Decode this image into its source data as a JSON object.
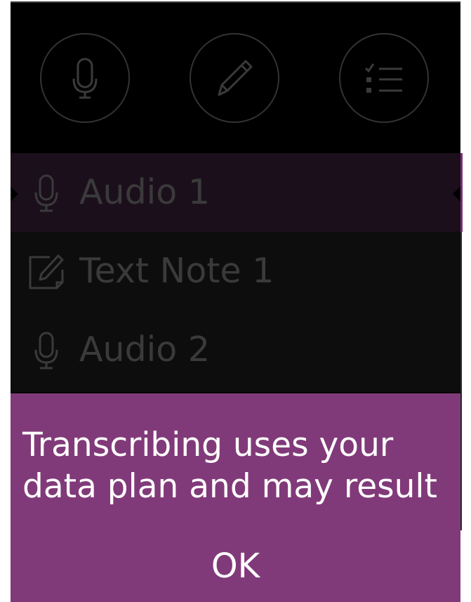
{
  "toolbar": {
    "buttons": [
      {
        "name": "record-audio",
        "icon": "microphone-icon"
      },
      {
        "name": "new-text-note",
        "icon": "pencil-icon"
      },
      {
        "name": "new-list",
        "icon": "checklist-icon"
      }
    ]
  },
  "notes": [
    {
      "label": "Audio 1",
      "icon": "microphone-icon",
      "selected": true
    },
    {
      "label": "Text Note 1",
      "icon": "edit-note-icon",
      "selected": false
    },
    {
      "label": "Audio 2",
      "icon": "microphone-icon",
      "selected": false
    }
  ],
  "dialog": {
    "message": "Transcribing uses your data plan and may result",
    "ok_label": "OK"
  },
  "colors": {
    "accent": "#813a79",
    "selected_row": "#1c0f1c",
    "dim_text": "#3a3a3a",
    "background": "#000000"
  }
}
